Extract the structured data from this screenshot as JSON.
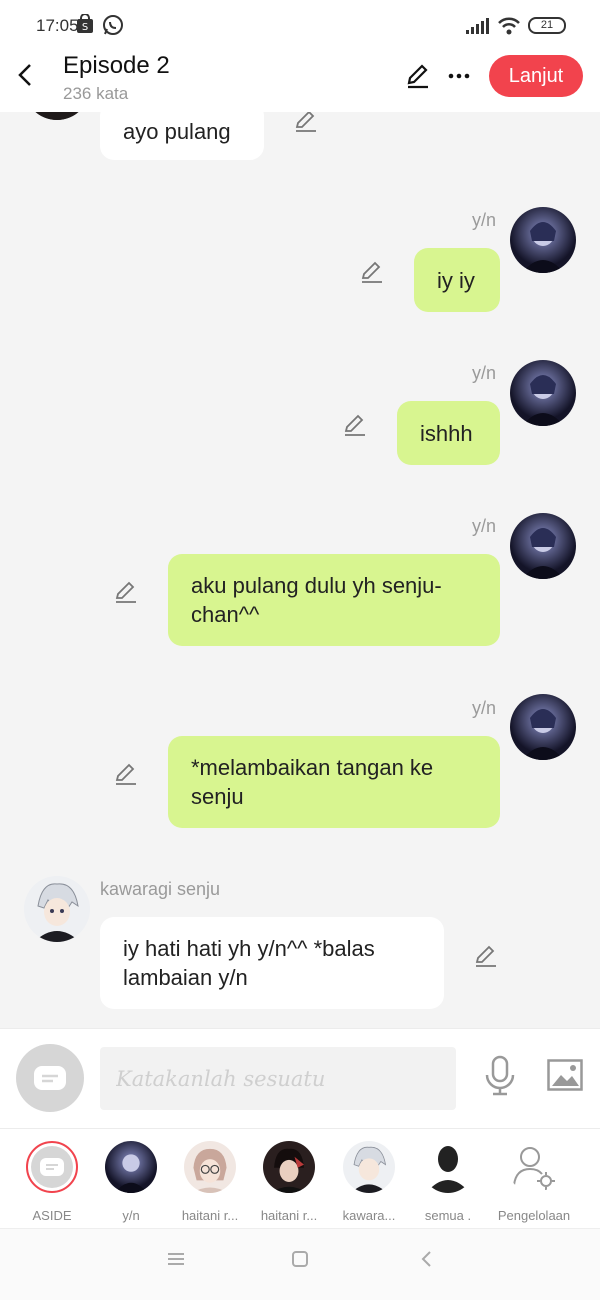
{
  "status_bar": {
    "time": "17:05",
    "battery": "21"
  },
  "header": {
    "title": "Episode 2",
    "word_count": "236 kata",
    "next_label": "Lanjut"
  },
  "messages": [
    {
      "side": "in",
      "sender": "",
      "text": "ayo pulang"
    },
    {
      "side": "out",
      "sender": "y/n",
      "text": "iy iy"
    },
    {
      "side": "out",
      "sender": "y/n",
      "text": "ishhh"
    },
    {
      "side": "out",
      "sender": "y/n",
      "text": "aku pulang dulu yh senju-chan^^"
    },
    {
      "side": "out",
      "sender": "y/n",
      "text": "*melambaikan tangan ke senju"
    },
    {
      "side": "in",
      "sender": "kawaragi senju",
      "text": "iy hati hati yh y/n^^ *balas lambaian y/n"
    }
  ],
  "composer": {
    "placeholder": "Katakanlah sesuatu"
  },
  "characters": [
    {
      "label": "ASIDE"
    },
    {
      "label": "y/n"
    },
    {
      "label": "haitani r..."
    },
    {
      "label": "haitani r..."
    },
    {
      "label": "kawara..."
    },
    {
      "label": "semua ."
    },
    {
      "label": "Pengelolaan"
    }
  ],
  "colors": {
    "accent": "#f2434d",
    "outgoing_bubble": "#d8f590",
    "incoming_bubble": "#ffffff"
  }
}
